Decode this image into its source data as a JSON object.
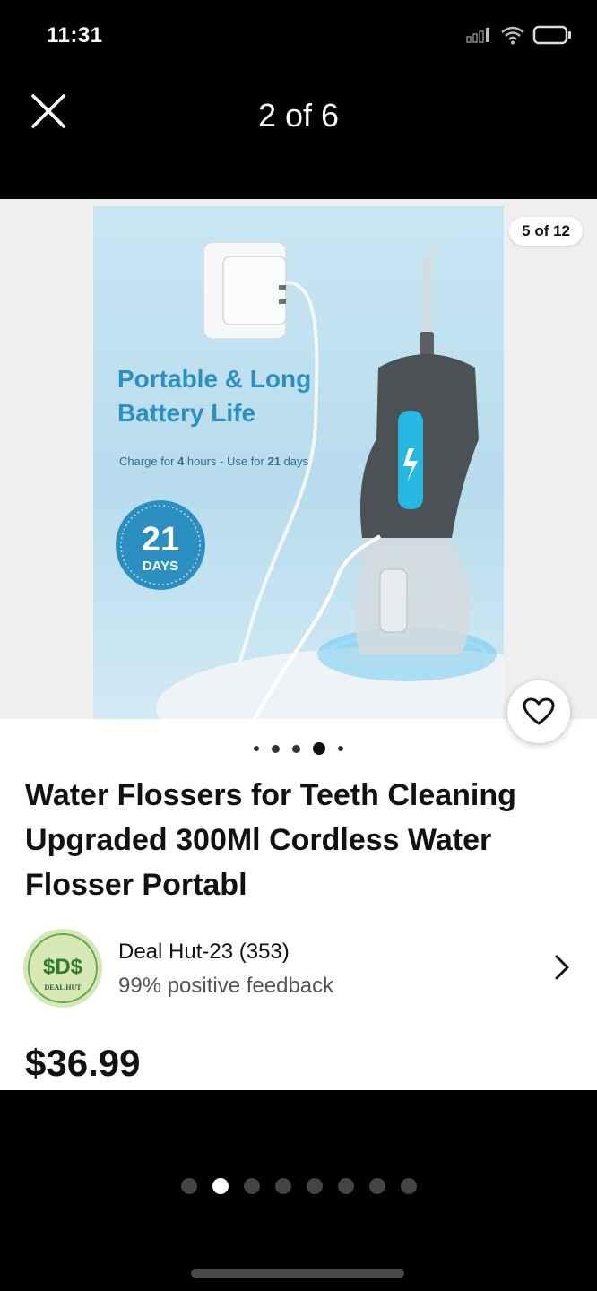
{
  "status_bar": {
    "time": "11:31"
  },
  "header": {
    "pager": "2 of 6"
  },
  "listing": {
    "image_counter": "5 of 12",
    "image_text": {
      "headline_1": "Portable & Long",
      "headline_2": "Battery Life",
      "charge_prefix": "Charge for ",
      "charge_hours": "4",
      "charge_mid": " hours - Use for ",
      "charge_days": "21",
      "charge_suffix": " days",
      "badge_number": "21",
      "badge_unit": "DAYS"
    },
    "title": "Water Flossers for Teeth Cleaning Upgraded 300Ml Cordless Water Flosser Portabl",
    "seller": {
      "name": "Deal Hut-23 (353)",
      "feedback": "99% positive feedback",
      "logo_text": "$D$",
      "logo_caption": "DEAL HUT"
    },
    "price": "$36.99",
    "image_dots": {
      "count": 5,
      "active_index": 3
    }
  },
  "gallery_dots": {
    "count": 8,
    "active_index": 1
  },
  "colors": {
    "background": "#000000",
    "card": "#ffffff",
    "text_primary": "#111111",
    "text_secondary": "#555555",
    "image_accent": "#2b8fc2"
  },
  "icons": {
    "close": "close-icon",
    "favorite": "heart-icon",
    "seller_nav": "chevron-right-icon"
  }
}
